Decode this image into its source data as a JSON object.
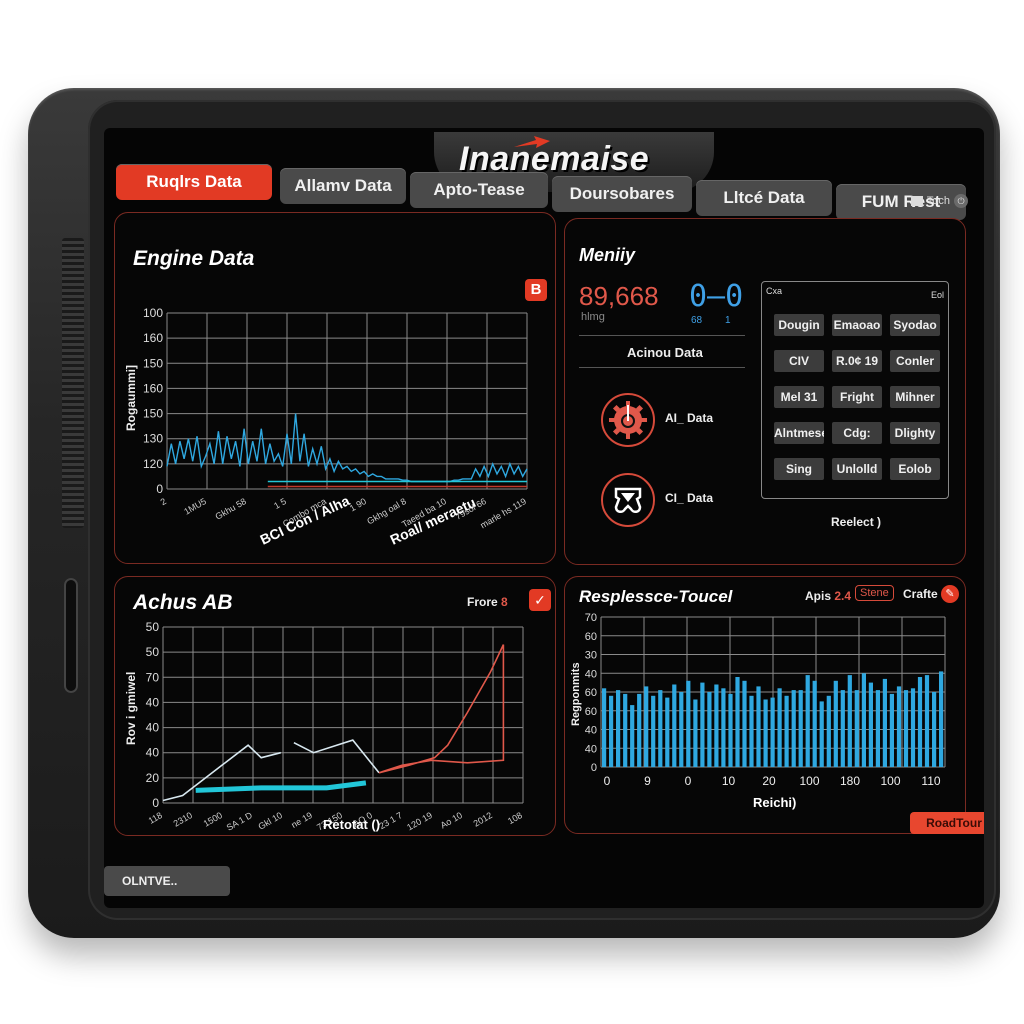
{
  "app": {
    "brand": "Inanemaise",
    "colors": {
      "accent": "#e23a24",
      "series_blue": "#2fa8e0",
      "series_cyan": "#22c6d8",
      "series_red": "#e0584a",
      "panel_border": "#7a2a22"
    }
  },
  "tabs": [
    {
      "label": "Ruqlrs Data",
      "active": true
    },
    {
      "label": "Allamv Data",
      "active": false
    },
    {
      "label": "Apto-Tease",
      "active": false
    },
    {
      "label": "Doursobares",
      "active": false
    },
    {
      "label": "Lltcé Data",
      "active": false
    },
    {
      "label": "FUM Rest",
      "active": false
    }
  ],
  "status": {
    "label": "Toch",
    "icons": [
      "window-icon",
      "power-icon"
    ]
  },
  "engine_panel": {
    "title": "Engine Data",
    "badge": "B"
  },
  "memory_panel": {
    "title": "Meniiy",
    "big_value": "89,668",
    "big_unit": "hlmg",
    "segment_display": "0–0",
    "segment_sub_left": "68",
    "segment_sub_right": "1",
    "section_label": "Acinou Data",
    "items": [
      {
        "icon": "gear-gauge-icon",
        "label": "AI_ Data"
      },
      {
        "icon": "seat-icon",
        "label": "CI_ Data"
      }
    ],
    "grid": {
      "corner_left": "Cxa",
      "corner_right": "Eol",
      "buttons": [
        "Dougin",
        "Emaoao",
        "Syodao",
        "CIV",
        "R.0¢ 19",
        "Conler",
        "Mel 31",
        "Fright",
        "Mihner",
        "Alntmese",
        "Cdg:",
        "Dlighty",
        "Sing",
        "Unlolld",
        "Eolob"
      ],
      "footer": "Reelect )"
    }
  },
  "achus_panel": {
    "title": "Achus AB",
    "frore_label": "Frore",
    "frore_value": "8",
    "checkbox_checked": true
  },
  "resp_panel": {
    "title": "Resplessce-Toucel",
    "apis_label": "Apis",
    "apis_value": "2.4",
    "outlined_button": "Stene",
    "crafte_label": "Crafte",
    "edit_icon": "pencil-icon"
  },
  "footer": {
    "left_button": "OLNTVE..",
    "right_button": "RoadTour"
  },
  "chart_data": [
    {
      "id": "engine",
      "type": "line",
      "title": "Engine Data",
      "ylabel": "Rogaummi]",
      "xlabel_segments": [
        "BCI Con / Alha",
        "Roal/ meraetu"
      ],
      "ytick_labels": [
        "100",
        "160",
        "150",
        "160",
        "150",
        "130",
        "120",
        "0"
      ],
      "xtick_labels": [
        "2",
        "1MU5",
        "Gkhu 58",
        "1 5",
        "Combo mca",
        "1 90",
        "Gkhg oal 8",
        "Taeed ba 10",
        "79sol 66",
        "marle hs 119"
      ],
      "ylim": [
        0,
        7
      ],
      "grid": true,
      "series": [
        {
          "name": "sensor-a",
          "color": "#2fa8e0",
          "values": [
            0.9,
            1.8,
            1.0,
            1.9,
            1.2,
            2.0,
            1.1,
            2.1,
            0.9,
            1.3,
            1.8,
            1.0,
            2.3,
            1.0,
            2.1,
            1.2,
            1.9,
            0.9,
            2.4,
            1.0,
            1.9,
            1.1,
            2.4,
            1.0,
            1.8,
            1.1,
            1.4,
            0.9,
            2.2,
            1.0,
            3.0,
            1.1,
            2.2,
            0.9,
            1.6,
            1.0,
            1.7,
            0.8,
            1.2,
            0.7,
            1.1,
            0.8,
            0.9,
            0.7,
            0.8,
            0.6,
            0.7,
            0.5,
            0.6,
            0.5,
            0.5,
            0.4,
            0.4,
            0.4,
            0.4,
            0.35,
            0.35,
            0.3,
            0.3,
            0.3,
            0.3,
            0.3,
            0.3,
            0.3,
            0.3,
            0.3,
            0.3,
            0.35,
            0.35,
            0.4,
            0.4,
            0.4,
            0.8,
            0.5,
            0.9,
            0.5,
            1.0,
            0.6,
            0.9,
            0.5,
            1.0,
            0.6,
            0.9,
            0.5,
            0.8
          ]
        },
        {
          "name": "baseline",
          "color": "#22c6d8",
          "values": [
            0.3,
            0.3,
            0.3,
            0.3,
            0.3,
            0.3,
            0.3,
            0.3,
            0.3,
            0.3
          ]
        },
        {
          "name": "reference",
          "color": "#c0392b",
          "values": [
            0.1,
            0.1,
            0.1,
            0.1,
            0.1,
            0.1,
            0.1,
            0.1,
            0.1,
            0.1
          ]
        }
      ]
    },
    {
      "id": "achus",
      "type": "line",
      "title": "Achus AB",
      "ylabel": "Rov i gmiwel",
      "xlabel": "Retotat ()",
      "ytick_labels": [
        "50",
        "50",
        "70",
        "40",
        "40",
        "40",
        "20",
        "0"
      ],
      "xtick_labels": [
        "118",
        "2310",
        "1500",
        "SA 1 D",
        "Gkl 10",
        "ne 19",
        "73 150",
        "AO 0",
        "23 1 7",
        "120 19",
        "Ao 10",
        "2012",
        "108"
      ],
      "ylim": [
        0,
        7
      ],
      "grid": true,
      "series": [
        {
          "name": "white-trace",
          "color": "#d8e8f0",
          "x": [
            0,
            0.6,
            1.8,
            2.6,
            3.0,
            3.6
          ],
          "y": [
            0.1,
            0.3,
            1.5,
            2.3,
            1.8,
            2.0
          ]
        },
        {
          "name": "white-trace-2",
          "color": "#d8e8f0",
          "x": [
            4.0,
            4.6,
            5.8,
            6.6
          ],
          "y": [
            2.4,
            2.0,
            2.5,
            1.2
          ]
        },
        {
          "name": "cyan-band",
          "color": "#22c6d8",
          "x": [
            1.0,
            3.0,
            5.0,
            6.2
          ],
          "y": [
            0.5,
            0.6,
            0.6,
            0.8
          ]
        },
        {
          "name": "red-trace",
          "color": "#e0584a",
          "x": [
            6.6,
            7.5,
            8.3,
            8.7,
            9.3,
            10.0,
            10.4,
            10.4,
            9.3,
            8.2,
            7.3,
            6.6
          ],
          "y": [
            1.2,
            1.5,
            1.8,
            2.3,
            3.6,
            5.2,
            6.3,
            1.7,
            1.6,
            1.7,
            1.5,
            1.2
          ]
        }
      ],
      "xlim": [
        0,
        11
      ]
    },
    {
      "id": "resp",
      "type": "bar",
      "title": "Resplessce-Toucel",
      "ylabel": "Regponmits",
      "xlabel": "Reichi)",
      "ytick_labels": [
        "70",
        "60",
        "30",
        "40",
        "60",
        "60",
        "40",
        "40",
        "0"
      ],
      "xtick_labels": [
        "0",
        "9",
        "0",
        "10",
        "20",
        "100",
        "180",
        "100",
        "110"
      ],
      "ylim": [
        0,
        8
      ],
      "grid": true,
      "series": [
        {
          "name": "response",
          "color": "#2fa8e0",
          "values": [
            4.2,
            3.8,
            4.1,
            3.9,
            3.3,
            3.9,
            4.3,
            3.8,
            4.1,
            3.7,
            4.4,
            4.0,
            4.6,
            3.6,
            4.5,
            4.0,
            4.4,
            4.2,
            3.9,
            4.8,
            4.6,
            3.8,
            4.3,
            3.6,
            3.7,
            4.2,
            3.8,
            4.1,
            4.1,
            4.9,
            4.6,
            3.5,
            3.8,
            4.6,
            4.1,
            4.9,
            4.1,
            5.0,
            4.5,
            4.1,
            4.7,
            3.9,
            4.3,
            4.1,
            4.2,
            4.8,
            4.9,
            4.0,
            5.1
          ]
        }
      ]
    }
  ]
}
